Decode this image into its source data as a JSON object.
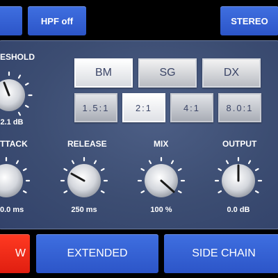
{
  "top_bar": {
    "hpf_label": "HPF off",
    "stereo_label": "STEREO"
  },
  "panel": {
    "threshold": {
      "label": "ESHOLD",
      "value": "2.1 dB"
    },
    "modes": [
      "BM",
      "SG",
      "DX"
    ],
    "active_mode": "BM",
    "ratios": [
      "1.5:1",
      "2:1",
      "4:1",
      "8.0:1"
    ],
    "active_ratio": "2:1",
    "knobs": [
      {
        "label": "TTACK",
        "value": "0.0 ms"
      },
      {
        "label": "RELEASE",
        "value": "250 ms"
      },
      {
        "label": "MIX",
        "value": "100 %"
      },
      {
        "label": "OUTPUT",
        "value": "0.0 dB"
      }
    ]
  },
  "bottom_bar": {
    "red_label": "W",
    "extended_label": "EXTENDED",
    "sidechain_label": "SIDE CHAIN"
  },
  "colors": {
    "button_blue": "#3461d6",
    "panel_bg": "#3f5075",
    "alert_red": "#f02a18",
    "text": "#ffffff"
  }
}
